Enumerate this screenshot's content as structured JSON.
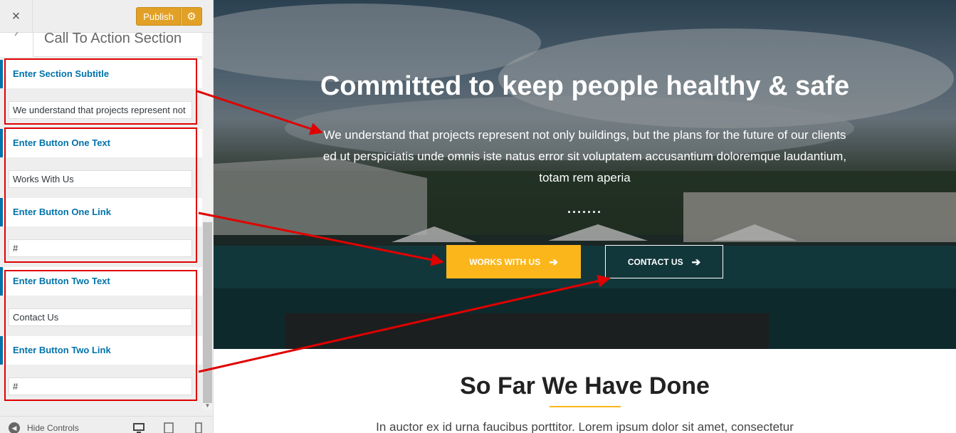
{
  "customizer": {
    "close_label": "×",
    "publish_label": "Publish",
    "settings_icon": "⚙",
    "section_title": "Call To Action Section",
    "controls": [
      {
        "label": "Enter Section Subtitle",
        "value": "We understand that projects represent not only buildings, but the plans for the future of our clients"
      },
      {
        "label": "Enter Button One Text",
        "value": "Works With Us"
      },
      {
        "label": "Enter Button One Link",
        "value": "#"
      },
      {
        "label": "Enter Button Two Text",
        "value": "Contact Us"
      },
      {
        "label": "Enter Button Two Link",
        "value": "#"
      }
    ],
    "footer": {
      "hide_controls_label": "Hide Controls"
    }
  },
  "preview": {
    "hero": {
      "title": "Committed to keep people healthy & safe",
      "text": "We understand that projects represent not only buildings, but the plans for the future of our clients ed ut perspiciatis unde omnis iste natus error sit voluptatem accusantium doloremque laudantium, totam rem aperia",
      "dots": ".......",
      "button_one": "WORKS WITH US",
      "button_two": "CONTACT US"
    },
    "next_section": {
      "title": "So Far We Have Done",
      "text": "In auctor ex id urna faucibus porttitor. Lorem ipsum dolor sit amet, consectetur"
    }
  },
  "colors": {
    "publish": "#e2a126",
    "accent_blue": "#0073aa",
    "cta_yellow": "#fbb61b",
    "annotation_red": "#e00000"
  }
}
